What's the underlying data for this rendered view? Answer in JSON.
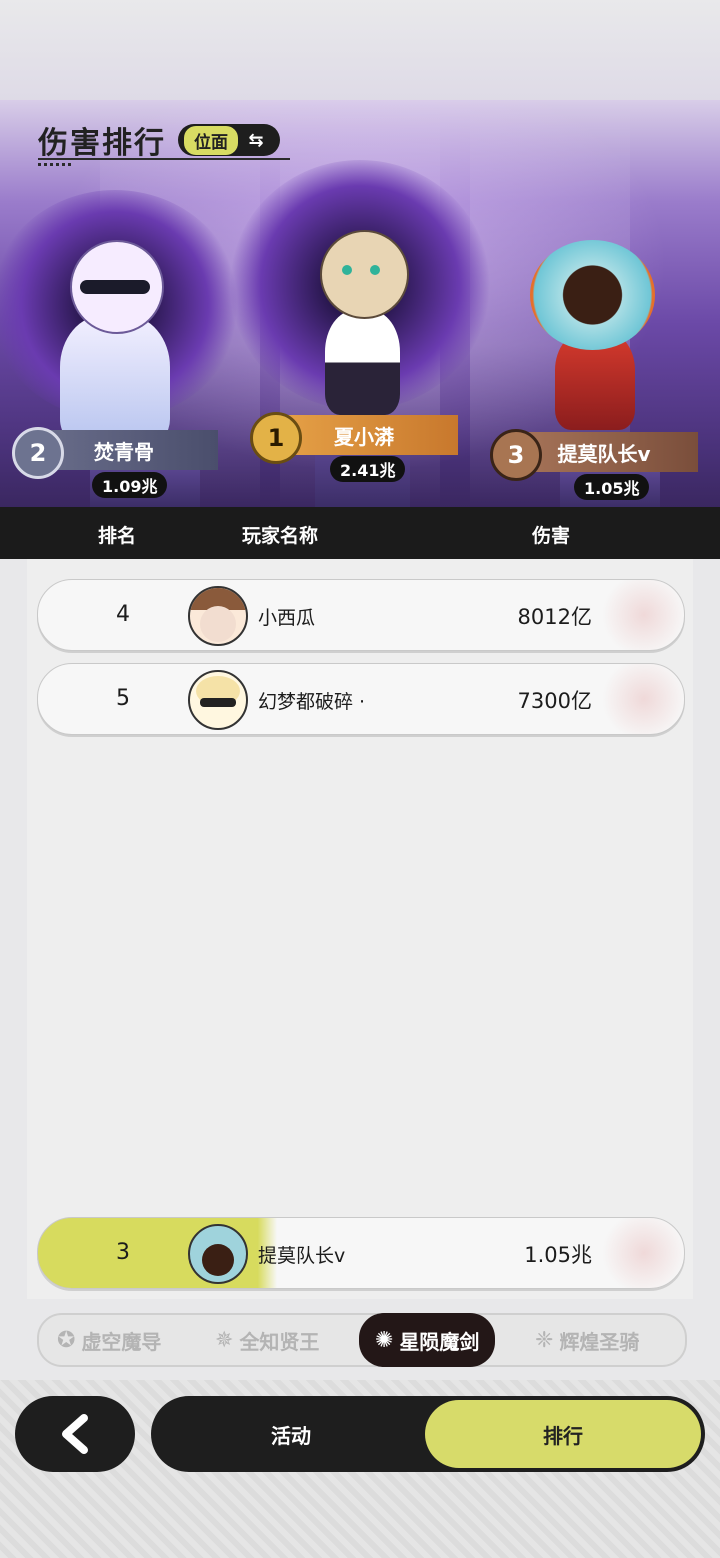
{
  "header": {
    "title": "伤害排行",
    "view_toggle_label": "位面",
    "toggle_icon": "swap-icon"
  },
  "podium": [
    {
      "rank": "2",
      "name": "焚青骨",
      "score": "1.09兆"
    },
    {
      "rank": "1",
      "name": "夏小漭",
      "score": "2.41兆"
    },
    {
      "rank": "3",
      "name": "提莫队长v",
      "score": "1.05兆"
    }
  ],
  "table": {
    "columns": [
      "排名",
      "玩家名称",
      "伤害"
    ],
    "rows": [
      {
        "rank": "4",
        "name": "小西瓜",
        "damage": "8012亿"
      },
      {
        "rank": "5",
        "name": "幻梦都破碎 ·",
        "damage": "7300亿"
      }
    ],
    "my_row": {
      "rank": "3",
      "name": "提莫队长v",
      "damage": "1.05兆"
    }
  },
  "categories": [
    {
      "label": "虚空魔导",
      "icon": "void-mage-icon",
      "active": false
    },
    {
      "label": "全知贤王",
      "icon": "sage-king-icon",
      "active": false
    },
    {
      "label": "星陨魔剑",
      "icon": "star-sword-icon",
      "active": true
    },
    {
      "label": "辉煌圣骑",
      "icon": "holy-knight-icon",
      "active": false
    }
  ],
  "nav": {
    "back_icon": "chevron-left-icon",
    "activity_label": "活动",
    "ranking_label": "排行"
  },
  "colors": {
    "accent": "#d7db6a",
    "dark": "#1e1e1e",
    "hero_purple": "#6b49a7"
  }
}
